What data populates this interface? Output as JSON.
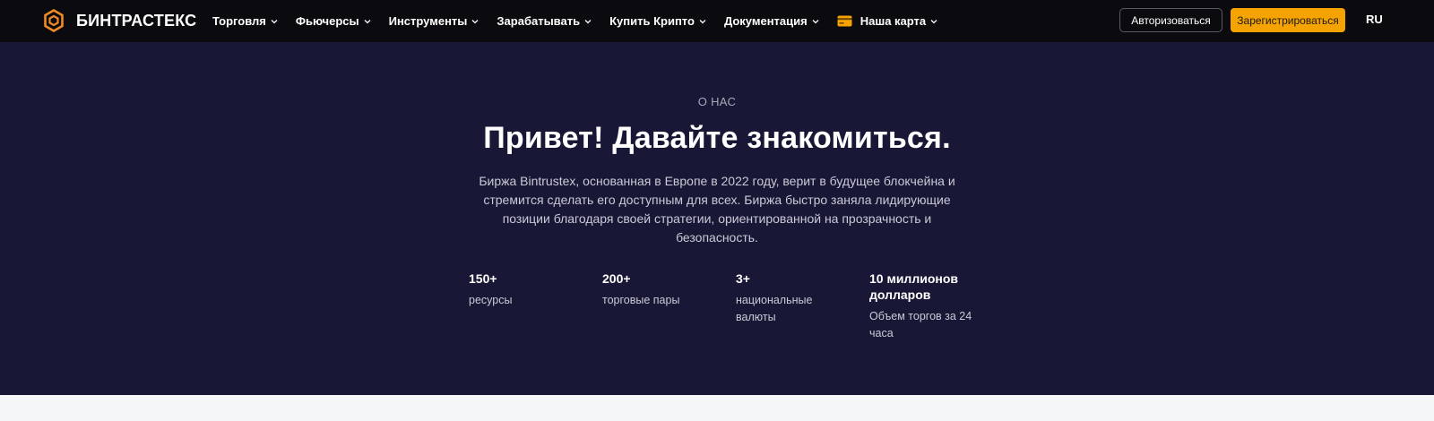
{
  "colors": {
    "nav_bg": "#0b0b0f",
    "hero_bg": "#181836",
    "accent": "#f5a300",
    "logo_orange": "#f08a24"
  },
  "brand": {
    "name": "БИНТРАСТЕКС",
    "logo_icon": "hexagon-logo-icon"
  },
  "nav": {
    "items": [
      {
        "label": "Торговля"
      },
      {
        "label": "Фьючерсы"
      },
      {
        "label": "Инструменты"
      },
      {
        "label": "Зарабатывать"
      },
      {
        "label": "Купить Крипто"
      },
      {
        "label": "Документация"
      },
      {
        "label": "Наша карта",
        "icon": "card-icon"
      }
    ],
    "login_label": "Авторизоваться",
    "register_label": "Зарегистрироваться",
    "lang": "RU"
  },
  "hero": {
    "eyebrow": "О НАС",
    "title": "Привет! Давайте знакомиться.",
    "description": "Биржа Bintrustex, основанная в Европе в 2022 году, верит в будущее блокчейна и стремится сделать его доступным для всех. Биржа быстро заняла лидирующие позиции благодаря своей стратегии, ориентированной на прозрачность и безопасность."
  },
  "stats": [
    {
      "value": "150+",
      "label": "ресурсы"
    },
    {
      "value": "200+",
      "label": "торговые пары"
    },
    {
      "value": "3+",
      "label": "национальные валюты"
    },
    {
      "value": "10 миллионов долларов",
      "label": "Объем торгов за 24 часа"
    }
  ]
}
